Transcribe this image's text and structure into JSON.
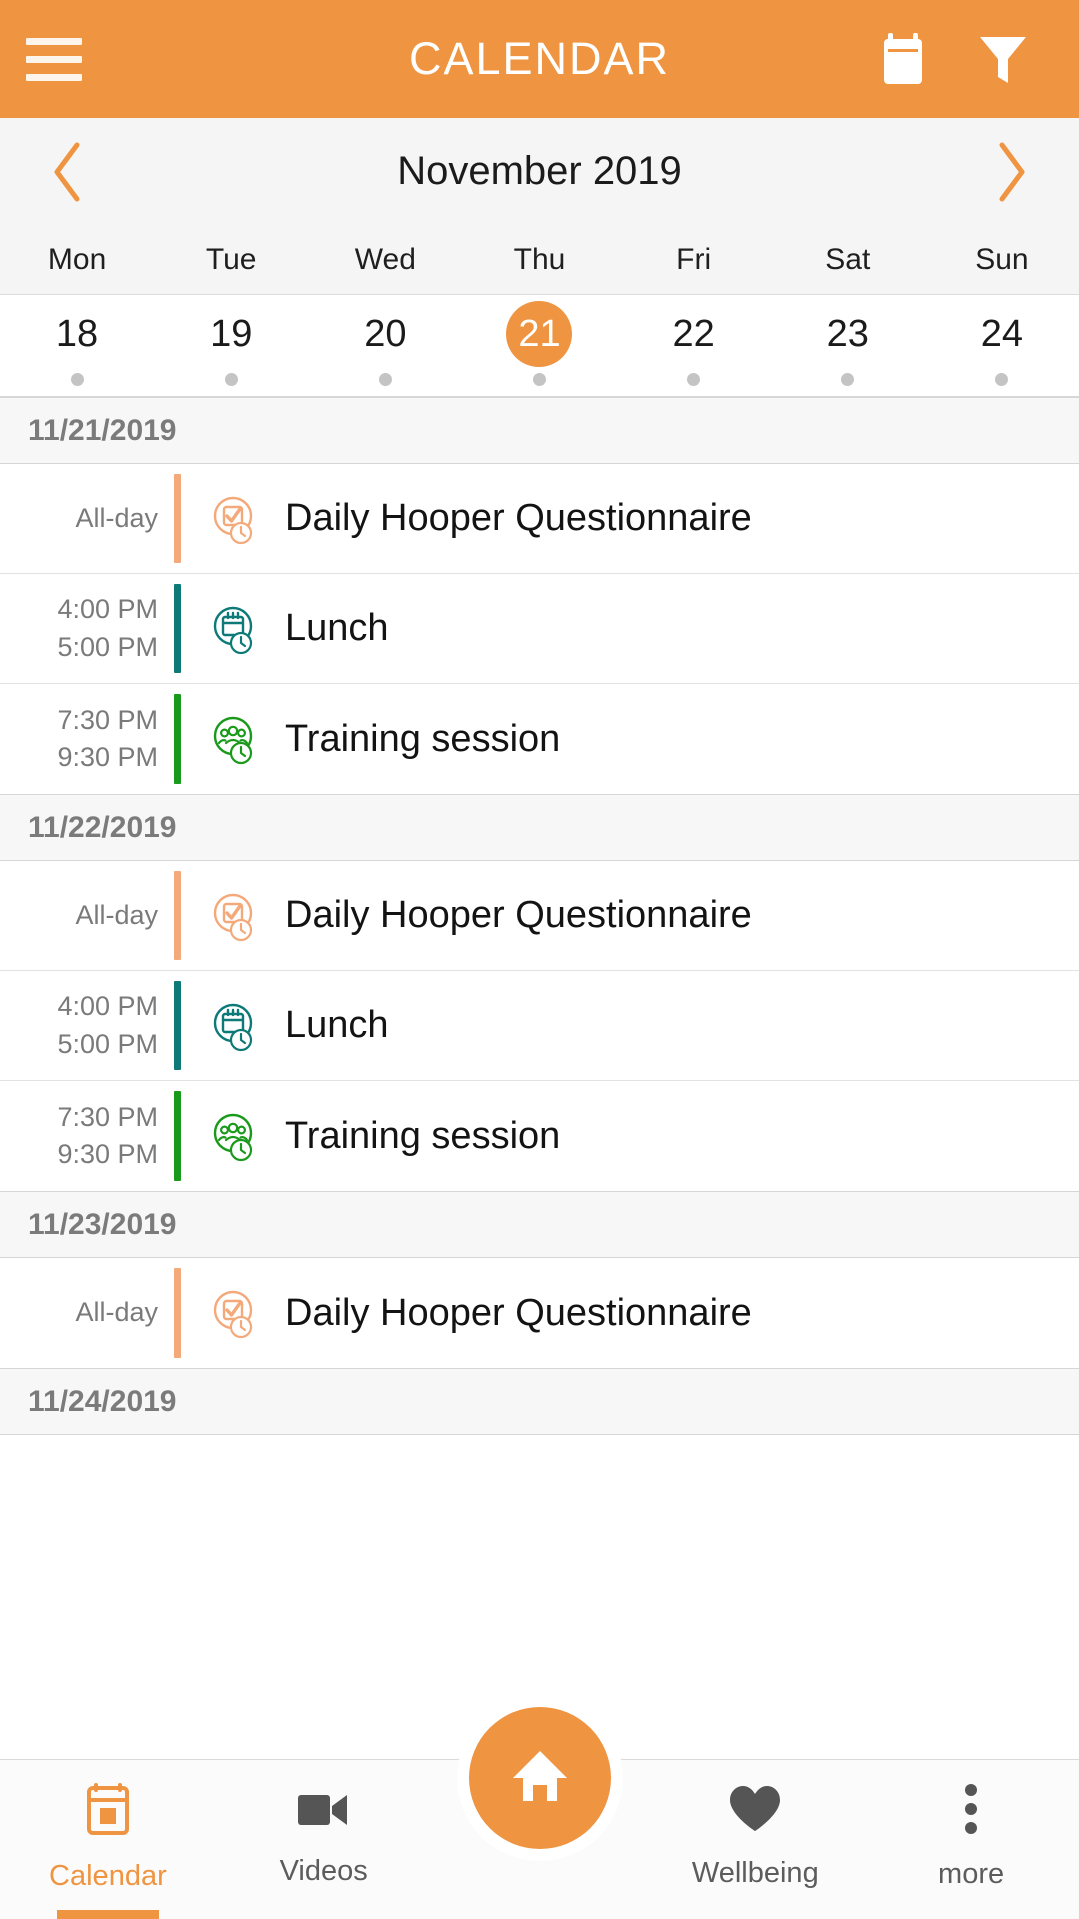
{
  "appbar": {
    "title": "CALENDAR",
    "menu_icon": "hamburger-menu-icon",
    "calendar_icon": "calendar-icon",
    "filter_icon": "filter-funnel-icon"
  },
  "month_nav": {
    "prev_icon": "chevron-left-icon",
    "next_icon": "chevron-right-icon",
    "month_label": "November 2019"
  },
  "weekdays": [
    "Mon",
    "Tue",
    "Wed",
    "Thu",
    "Fri",
    "Sat",
    "Sun"
  ],
  "dates": [
    {
      "day": "18",
      "selected": false,
      "has_events": true
    },
    {
      "day": "19",
      "selected": false,
      "has_events": true
    },
    {
      "day": "20",
      "selected": false,
      "has_events": true
    },
    {
      "day": "21",
      "selected": true,
      "has_events": true
    },
    {
      "day": "22",
      "selected": false,
      "has_events": true
    },
    {
      "day": "23",
      "selected": false,
      "has_events": true
    },
    {
      "day": "24",
      "selected": false,
      "has_events": true
    }
  ],
  "colors": {
    "accent_orange": "#ef9440",
    "questionnaire_orange": "#f4a97a",
    "lunch_teal": "#0d7a77",
    "training_green": "#1a9a1a",
    "date_header_text": "#7b7b7b"
  },
  "agenda": [
    {
      "date": "11/21/2019",
      "events": [
        {
          "start": "All-day",
          "end": "",
          "title": "Daily Hooper Questionnaire",
          "icon": "checklist-clock-icon",
          "color": "#f4a97a"
        },
        {
          "start": "4:00 PM",
          "end": "5:00 PM",
          "title": "Lunch",
          "icon": "calendar-clock-icon",
          "color": "#0d7a77"
        },
        {
          "start": "7:30 PM",
          "end": "9:30 PM",
          "title": "Training session",
          "icon": "group-clock-icon",
          "color": "#1a9a1a"
        }
      ]
    },
    {
      "date": "11/22/2019",
      "events": [
        {
          "start": "All-day",
          "end": "",
          "title": "Daily Hooper Questionnaire",
          "icon": "checklist-clock-icon",
          "color": "#f4a97a"
        },
        {
          "start": "4:00 PM",
          "end": "5:00 PM",
          "title": "Lunch",
          "icon": "calendar-clock-icon",
          "color": "#0d7a77"
        },
        {
          "start": "7:30 PM",
          "end": "9:30 PM",
          "title": "Training session",
          "icon": "group-clock-icon",
          "color": "#1a9a1a"
        }
      ]
    },
    {
      "date": "11/23/2019",
      "events": [
        {
          "start": "All-day",
          "end": "",
          "title": "Daily Hooper Questionnaire",
          "icon": "checklist-clock-icon",
          "color": "#f4a97a"
        }
      ]
    },
    {
      "date": "11/24/2019",
      "events": []
    }
  ],
  "bottom_nav": {
    "tabs": [
      {
        "label": "Calendar",
        "icon": "calendar-icon",
        "active": true
      },
      {
        "label": "Videos",
        "icon": "video-camera-icon",
        "active": false
      },
      {
        "label": "Wellbeing",
        "icon": "heart-icon",
        "active": false
      },
      {
        "label": "more",
        "icon": "more-dots-icon",
        "active": false
      }
    ],
    "home_button": {
      "icon": "home-icon"
    }
  }
}
